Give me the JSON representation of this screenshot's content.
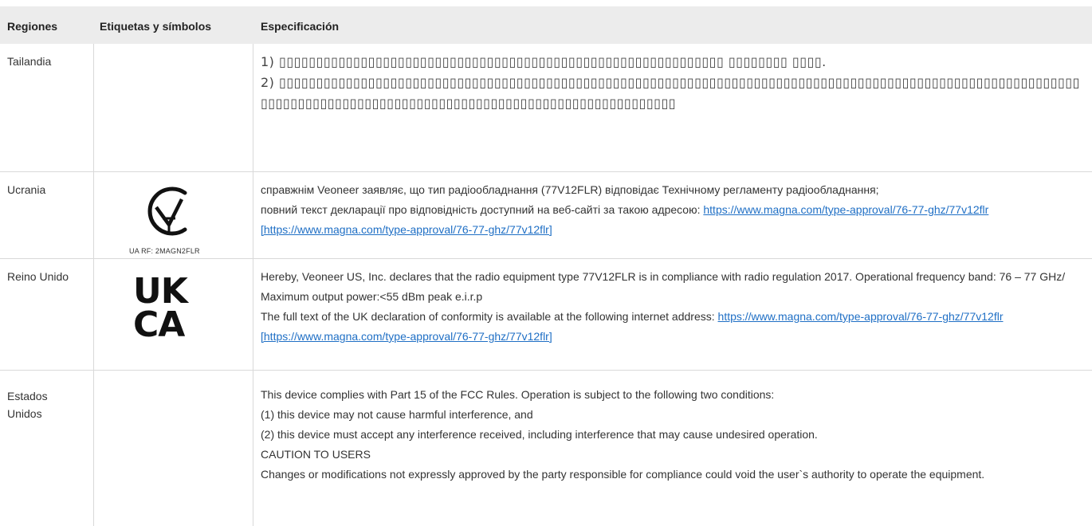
{
  "header": {
    "regions": "Regiones",
    "labels": "Etiquetas y símbolos",
    "spec": "Especificación"
  },
  "rows": [
    {
      "region": "Tailandia",
      "spec_line1": "1) ▯▯▯▯▯▯▯▯▯▯▯▯▯▯▯▯▯▯▯▯▯▯▯▯▯▯▯▯▯▯▯▯▯▯▯▯▯▯▯▯▯▯▯▯▯▯▯▯▯▯▯▯▯▯▯▯▯▯▯▯ ▯▯▯▯▯▯▯▯ ▯▯▯▯.",
      "spec_line2": "2) ▯▯▯▯▯▯▯▯▯▯▯▯▯▯▯▯▯▯▯▯▯▯▯▯▯▯▯▯▯▯▯▯▯▯▯▯▯▯▯▯▯▯▯▯▯▯▯▯▯▯▯▯▯▯▯▯▯▯▯▯▯▯▯▯▯▯▯▯▯▯▯▯▯▯▯▯▯▯▯▯▯▯▯▯▯▯▯▯▯▯▯▯▯▯▯▯▯▯▯▯▯▯▯▯▯▯▯▯▯▯▯▯▯▯▯▯▯▯▯▯▯▯▯▯▯▯▯▯▯▯▯▯▯▯▯▯▯▯▯▯▯▯▯▯▯▯▯▯▯▯▯▯▯▯▯▯▯▯▯▯▯▯▯▯"
    },
    {
      "region": "Ucrania",
      "logo_caption": "UA RF: 2MAGN2FLR",
      "spec_text1": "справжнім Veoneer заявляє, що тип радіообладнання (77V12FLR) відповідає Технічному регламенту радіообладнання;",
      "spec_text2": "повний текст декларації про відповідність доступний на веб-сайті за такою адресою: ",
      "spec_link": "https://www.magna.com/type-approval/76-77-ghz/77v12flr [https://www.magna.com/type-approval/76-77-ghz/77v12flr]"
    },
    {
      "region": "Reino Unido",
      "logo_text_top": "UK",
      "logo_text_bottom": "CA",
      "spec_text1": "Hereby, Veoneer US, Inc. declares that the radio equipment type 77V12FLR is in compliance with radio regulation 2017. Operational frequency band: 76 – 77 GHz/ Maximum output power:<55 dBm peak e.i.r.p",
      "spec_text2": "The full text of the UK declaration of conformity is available at the following internet address: ",
      "spec_link": "https://www.magna.com/type-approval/76-77-ghz/77v12flr [https://www.magna.com/type-approval/76-77-ghz/77v12flr]"
    },
    {
      "region": "Estados Unidos",
      "spec_lines": [
        "This device complies with Part 15 of the FCC Rules. Operation is subject to the following two conditions:",
        "(1) this device may not cause harmful interference, and",
        "(2) this device must accept any interference received, including interference that may cause undesired operation.",
        "CAUTION TO USERS",
        "Changes or modifications not expressly approved by the party responsible for compliance could void the user`s authority to operate the equipment."
      ]
    }
  ]
}
